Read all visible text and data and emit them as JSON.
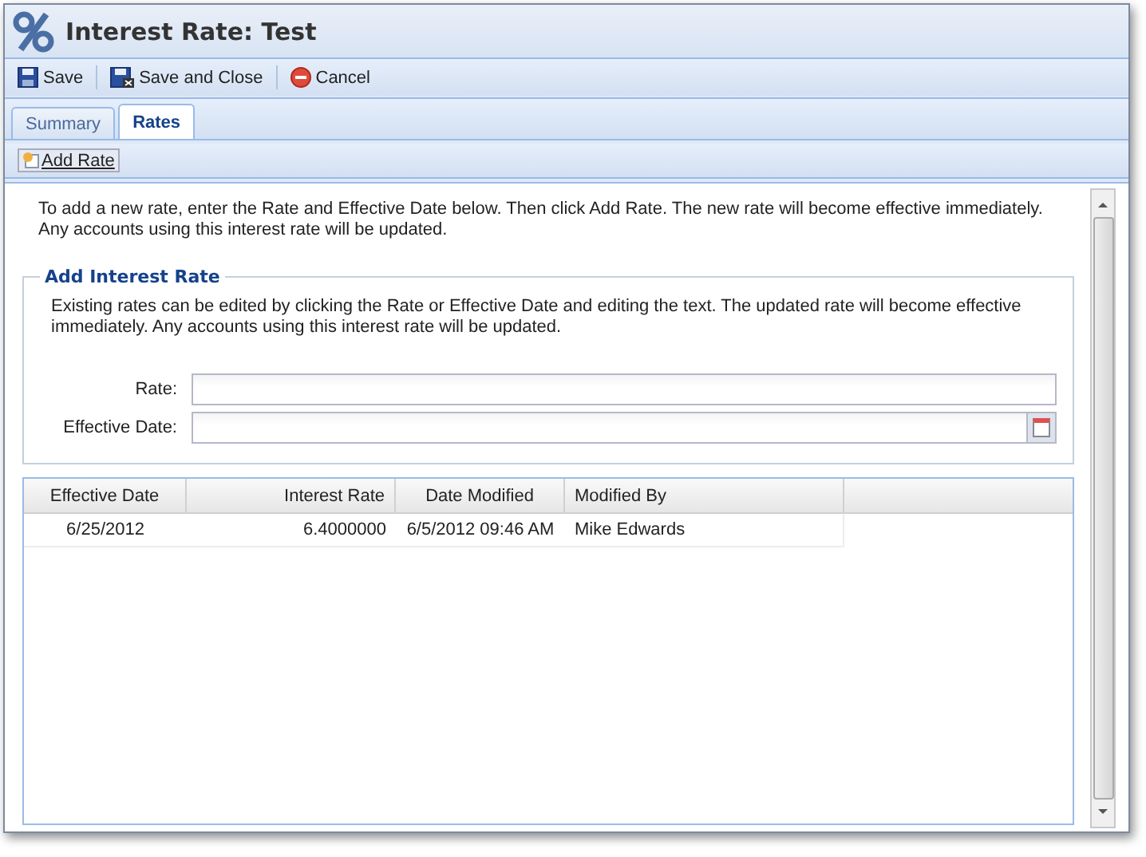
{
  "window": {
    "title": "Interest Rate: Test"
  },
  "toolbar": [
    {
      "kind": "save",
      "label": "Save"
    },
    {
      "kind": "save-close",
      "label": "Save and Close"
    },
    {
      "kind": "cancel",
      "label": "Cancel"
    }
  ],
  "tabs": [
    {
      "label": "Summary",
      "selected": false
    },
    {
      "label": "Rates",
      "selected": true
    }
  ],
  "add_rate_button": "Add Rate",
  "intro": "To add a new rate, enter the Rate and Effective Date below. Then click Add Rate. The new rate will become effective immediately. Any accounts using this interest rate will be updated.",
  "form": {
    "legend": "Add Interest Rate",
    "note": "Existing rates can be edited by clicking the Rate or Effective Date and editing the text. The updated rate will become effective immediately. Any accounts using this interest rate will be updated.",
    "fields": [
      {
        "kind": "text",
        "label": "Rate:"
      },
      {
        "kind": "date",
        "label": "Effective Date:"
      }
    ]
  },
  "table": {
    "columns": [
      "Effective Date",
      "Interest Rate",
      "Date Modified",
      "Modified By"
    ],
    "rows": [
      [
        "6/25/2012",
        "6.4000000",
        "6/5/2012 09:46 AM",
        "Mike Edwards"
      ]
    ]
  }
}
